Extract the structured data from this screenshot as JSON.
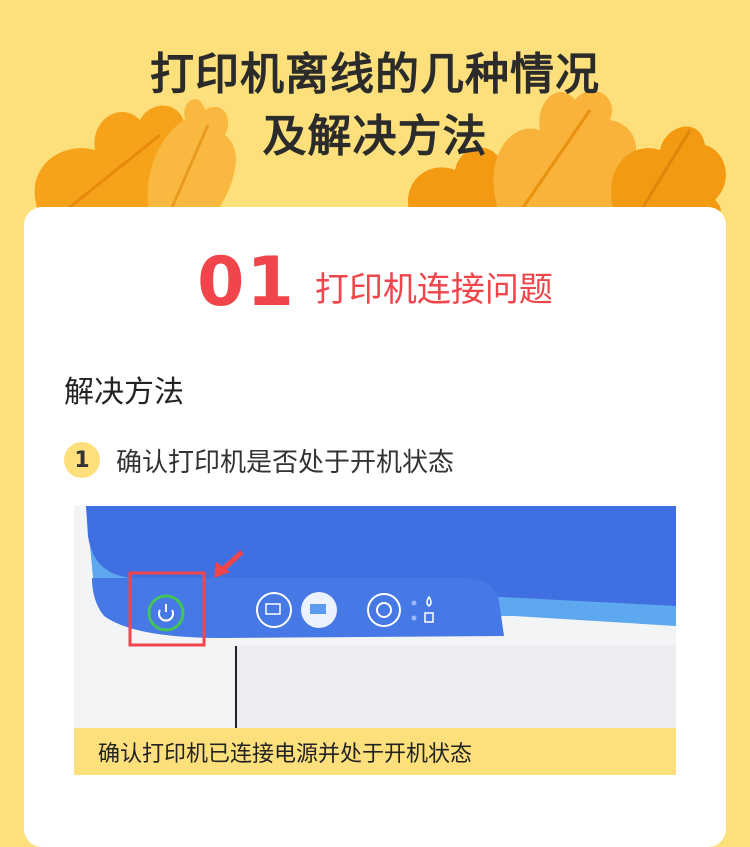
{
  "page": {
    "title_line1": "打印机离线的几种情况",
    "title_line2": "及解决方法"
  },
  "section": {
    "number": "01",
    "title": "打印机连接问题"
  },
  "solution_heading": "解决方法",
  "steps": [
    {
      "number": "1",
      "text": "确认打印机是否处于开机状态"
    }
  ],
  "figure": {
    "caption": "确认打印机已连接电源并处于开机状态"
  },
  "colors": {
    "background": "#fde07c",
    "accent_red": "#f0464b",
    "printer_blue": "#3f6fe0",
    "leaf_orange": "#f7a21b"
  }
}
